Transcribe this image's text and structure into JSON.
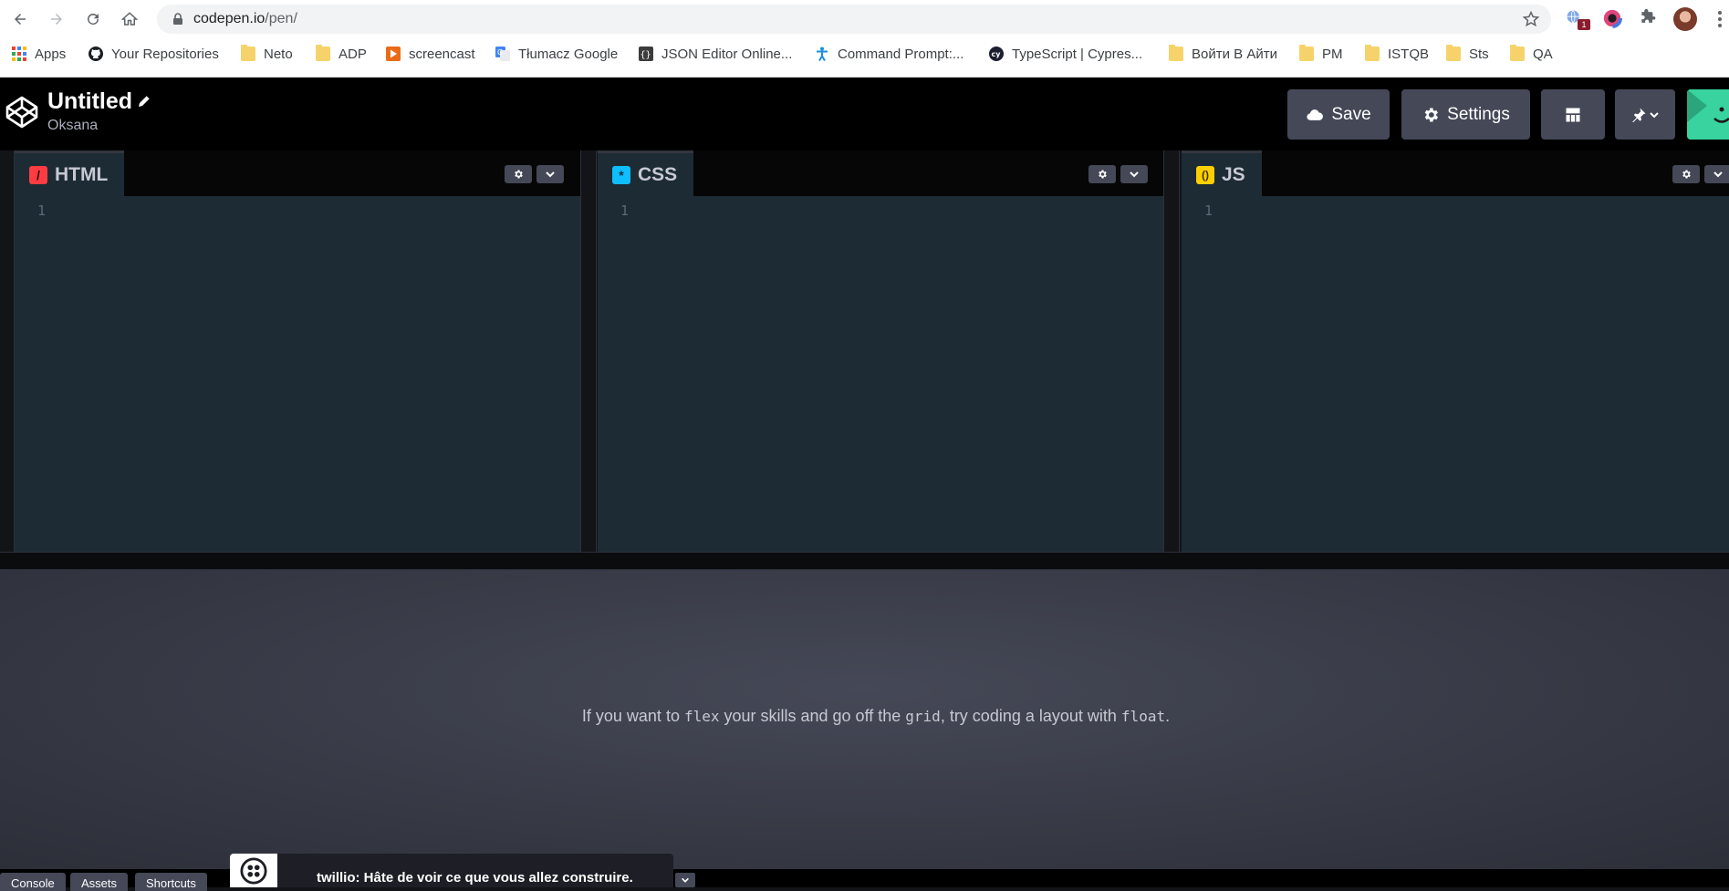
{
  "browser": {
    "url_host": "codepen.io",
    "url_path": "/pen/",
    "extension_badge": "1",
    "bookmarks": [
      {
        "label": "Apps",
        "icon": "apps-grid-icon"
      },
      {
        "label": "Your Repositories",
        "icon": "github-icon"
      },
      {
        "label": "Neto",
        "icon": "folder-icon"
      },
      {
        "label": "ADP",
        "icon": "folder-icon"
      },
      {
        "label": "screencast",
        "icon": "screencast-icon"
      },
      {
        "label": "Tłumacz Google",
        "icon": "google-translate-icon"
      },
      {
        "label": "JSON Editor Online...",
        "icon": "json-editor-icon"
      },
      {
        "label": "Command Prompt:...",
        "icon": "accessibility-icon"
      },
      {
        "label": "TypeScript | Cypres...",
        "icon": "cypress-icon"
      },
      {
        "label": "Войти В Айти",
        "icon": "folder-icon"
      },
      {
        "label": "PM",
        "icon": "folder-icon"
      },
      {
        "label": "ISTQB",
        "icon": "folder-icon"
      },
      {
        "label": "Sts",
        "icon": "folder-icon"
      },
      {
        "label": "QA",
        "icon": "folder-icon"
      }
    ]
  },
  "header": {
    "title": "Untitled",
    "owner": "Oksana",
    "save_label": "Save",
    "settings_label": "Settings"
  },
  "editors": [
    {
      "label": "HTML",
      "icon_color": "#ff3c41",
      "icon_glyph": "/",
      "line": "1"
    },
    {
      "label": "CSS",
      "icon_color": "#0ebeff",
      "icon_glyph": "*",
      "line": "1"
    },
    {
      "label": "JS",
      "icon_color": "#fcd000",
      "icon_glyph": "()",
      "line": "1"
    }
  ],
  "preview": {
    "msg_part1": "If you want to ",
    "code1": "flex",
    "msg_part2": " your skills and go off the ",
    "code2": "grid",
    "msg_part3": ", try coding a layout with ",
    "code3": "float",
    "msg_part4": "."
  },
  "footer": {
    "console_label": "Console",
    "assets_label": "Assets",
    "shortcuts_label": "Shortcuts",
    "ad_text": "twillio: Hâte de voir ce que vous allez construire."
  },
  "colors": {
    "html_accent": "#ff3c41",
    "css_accent": "#0ebeff",
    "js_accent": "#fcd000",
    "button_bg": "#444857",
    "editor_bg": "#1d2b35"
  }
}
